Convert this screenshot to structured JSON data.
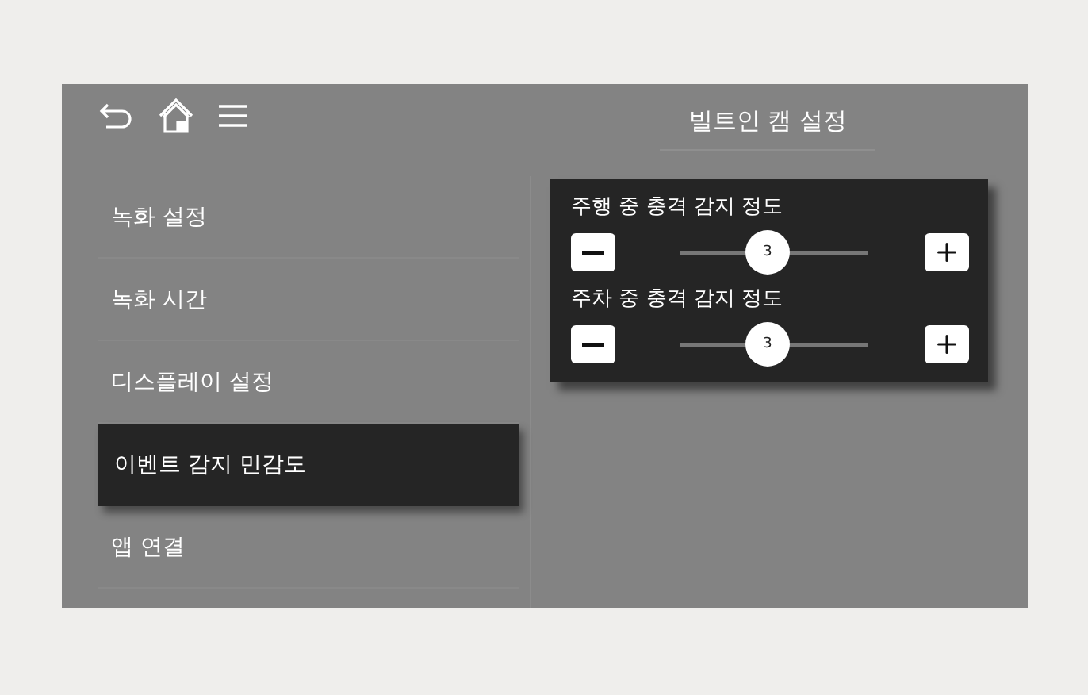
{
  "header": {
    "title": "빌트인 캠 설정"
  },
  "menu": [
    {
      "label": "녹화 설정",
      "selected": false
    },
    {
      "label": "녹화 시간",
      "selected": false
    },
    {
      "label": "디스플레이 설정",
      "selected": false
    },
    {
      "label": "이벤트 감지 민감도",
      "selected": true
    },
    {
      "label": "앱 연결",
      "selected": false
    }
  ],
  "settings": [
    {
      "label": "주행 중 충격 감지 정도",
      "level": 0.47,
      "reading": "3"
    },
    {
      "label": "주차 중 충격 감지 정도",
      "level": 0.47,
      "reading": "3"
    }
  ]
}
